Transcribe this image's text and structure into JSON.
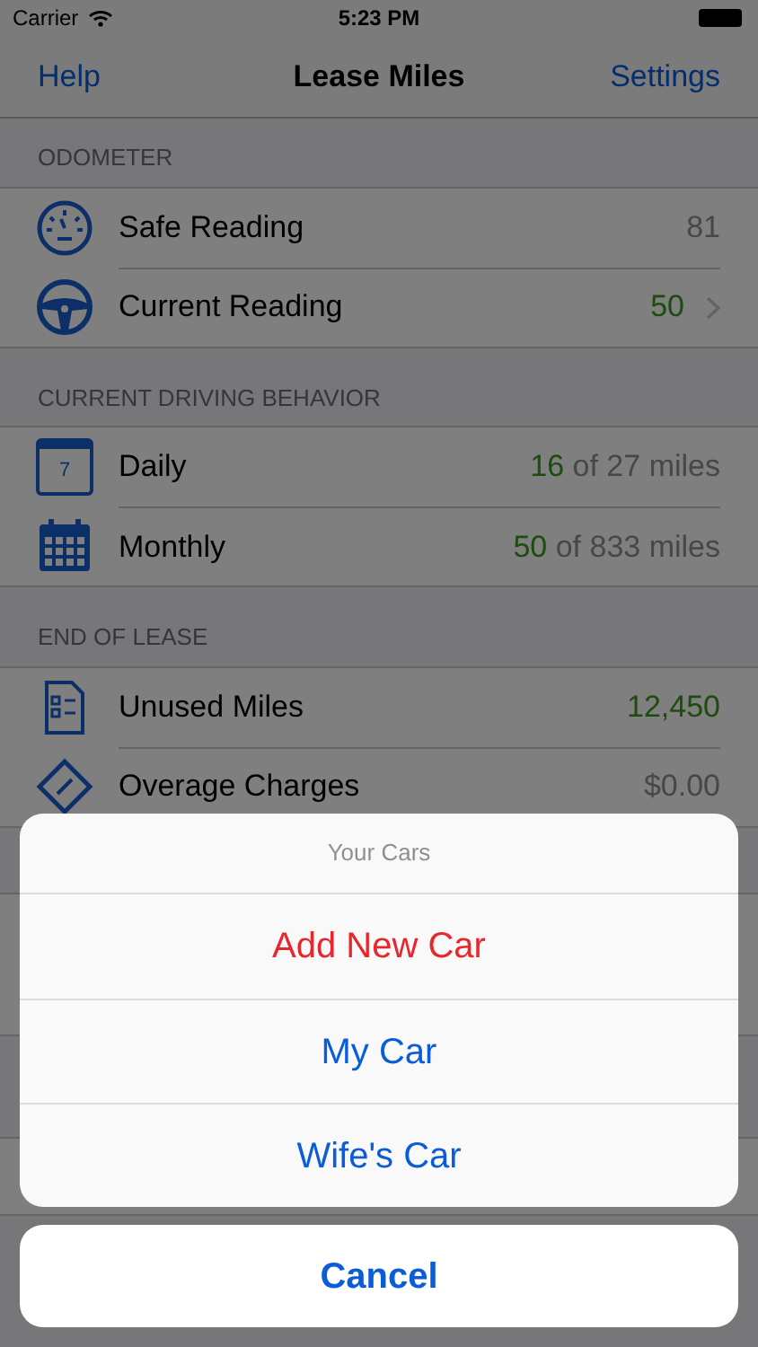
{
  "status_bar": {
    "carrier": "Carrier",
    "time": "5:23 PM"
  },
  "nav": {
    "left": "Help",
    "title": "Lease Miles",
    "right": "Settings"
  },
  "sections": [
    {
      "header": "ODOMETER",
      "rows": [
        {
          "label": "Safe Reading",
          "highlight": "",
          "value": "81",
          "disclosure": false
        },
        {
          "label": "Current Reading",
          "highlight": "50",
          "value": "",
          "disclosure": true
        }
      ]
    },
    {
      "header": "CURRENT DRIVING BEHAVIOR",
      "rows": [
        {
          "label": "Daily",
          "icon_text": "7",
          "highlight": "16",
          "value": " of 27 miles",
          "disclosure": false
        },
        {
          "label": "Monthly",
          "highlight": "50",
          "value": " of 833 miles",
          "disclosure": false
        }
      ]
    },
    {
      "header": "END OF LEASE",
      "rows": [
        {
          "label": "Unused Miles",
          "highlight": "12,450",
          "value": "",
          "disclosure": false
        },
        {
          "label": "Overage Charges",
          "highlight": "",
          "value": "$0.00",
          "disclosure": false
        }
      ]
    }
  ],
  "action_sheet": {
    "title": "Your Cars",
    "actions": [
      {
        "label": "Add New Car",
        "kind": "destructive"
      },
      {
        "label": "My Car",
        "kind": "default"
      },
      {
        "label": "Wife's Car",
        "kind": "default"
      }
    ],
    "cancel": "Cancel"
  }
}
